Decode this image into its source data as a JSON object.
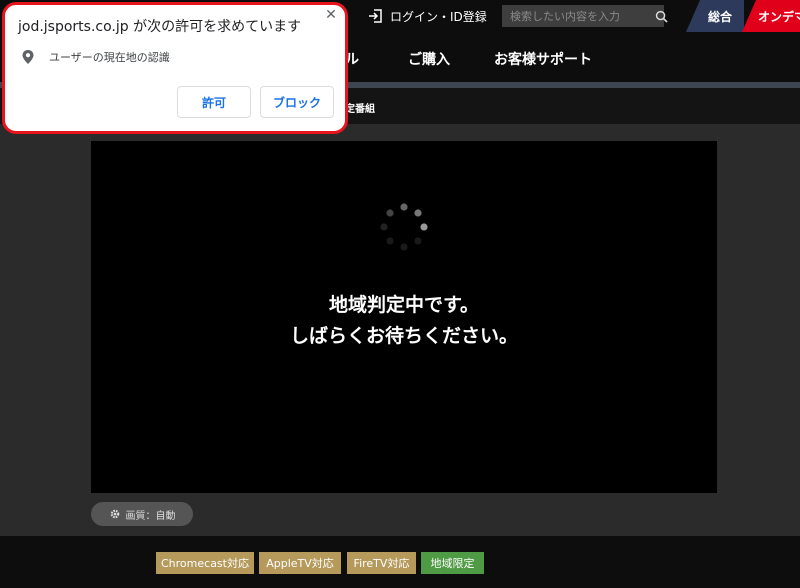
{
  "topbar": {
    "login_label": "ログイン・ID登録",
    "search_placeholder": "検索したい内容を入力",
    "tab_sogo": "総合",
    "tab_ondemand": "オンデマ"
  },
  "nav": {
    "items": [
      {
        "label": "ル"
      },
      {
        "label": "ご購入"
      },
      {
        "label": "お客様サポート"
      }
    ],
    "sub_label": "定番組"
  },
  "player": {
    "message_line1": "地域判定中です。",
    "message_line2": "しばらくお待ちください。",
    "quality_label": "画質：自動"
  },
  "tags": [
    {
      "label": "Chromecast対応",
      "color": "#b59a5b"
    },
    {
      "label": "AppleTV対応",
      "color": "#b59a5b"
    },
    {
      "label": "FireTV対応",
      "color": "#b59a5b"
    },
    {
      "label": "地域限定",
      "color": "#4f9a44"
    }
  ],
  "permission_popup": {
    "title": "jod.jsports.co.jp が次の許可を求めています",
    "permission": "ユーザーの現在地の認識",
    "allow_label": "許可",
    "block_label": "ブロック",
    "close_symbol": "✕",
    "border_color": "#e8141e"
  },
  "icons": [
    "login-icon",
    "search-icon",
    "gear-icon",
    "location-pin-icon",
    "close-icon",
    "loading-spinner-icon"
  ]
}
